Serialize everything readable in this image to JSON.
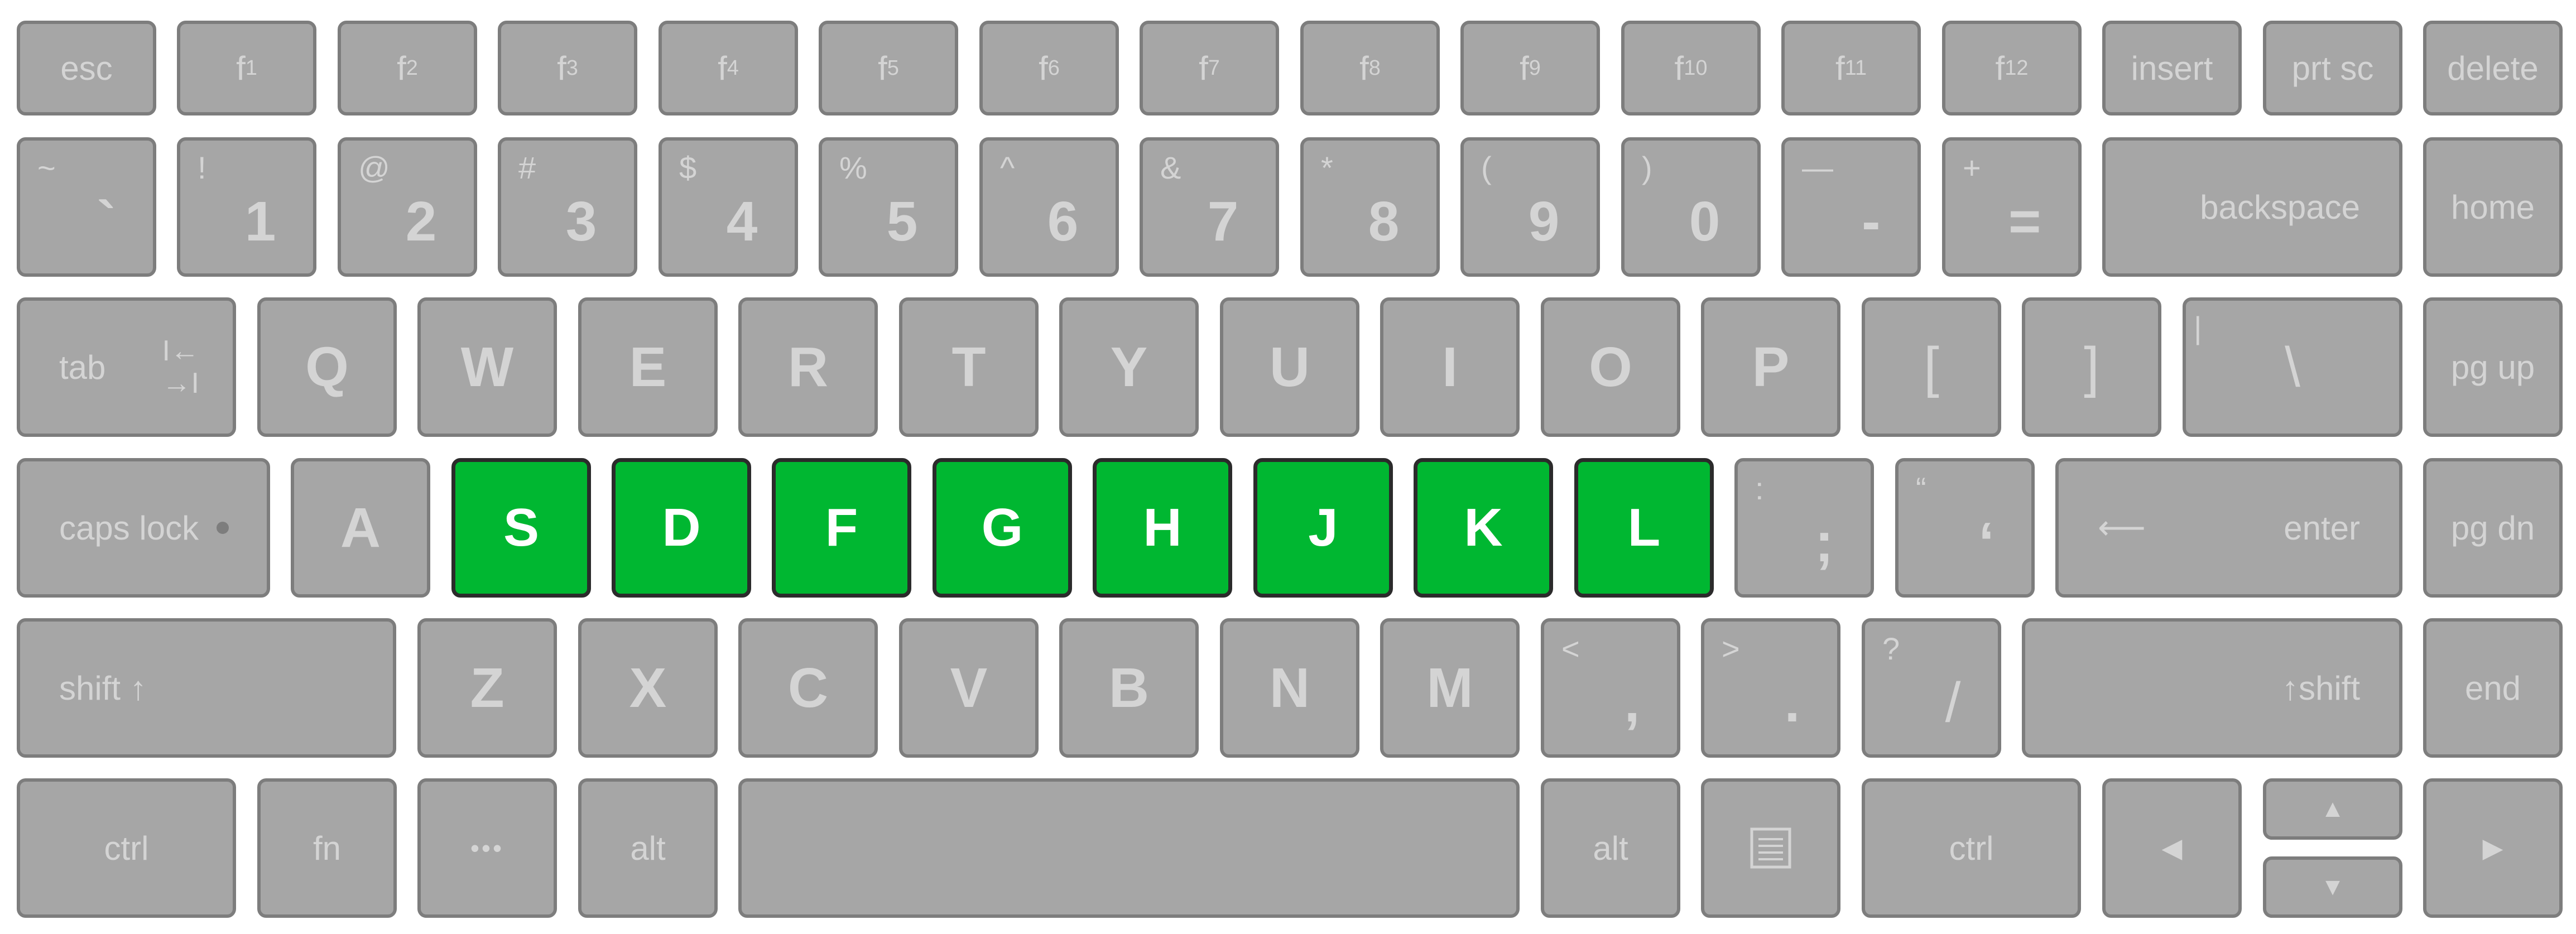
{
  "keyboard": {
    "highlight_color": "#00b731",
    "key_color": "#a6a6a6",
    "row1": {
      "esc": "esc",
      "f_prefix": "f",
      "f_nums": [
        "1",
        "2",
        "3",
        "4",
        "5",
        "6",
        "7",
        "8",
        "9",
        "10",
        "11",
        "12"
      ],
      "insert": "insert",
      "prtsc": "prt sc",
      "delete": "delete"
    },
    "row2": {
      "keys": [
        {
          "top": "~",
          "main": "`"
        },
        {
          "top": "!",
          "main": "1"
        },
        {
          "top": "@",
          "main": "2"
        },
        {
          "top": "#",
          "main": "3"
        },
        {
          "top": "$",
          "main": "4"
        },
        {
          "top": "%",
          "main": "5"
        },
        {
          "top": "^",
          "main": "6"
        },
        {
          "top": "&",
          "main": "7"
        },
        {
          "top": "*",
          "main": "8"
        },
        {
          "top": "(",
          "main": "9"
        },
        {
          "top": ")",
          "main": "0"
        },
        {
          "top": "—",
          "main": "-"
        },
        {
          "top": "+",
          "main": "="
        }
      ],
      "backspace": "backspace",
      "home": "home"
    },
    "row3": {
      "tab": "tab",
      "tab_icon_top": "I←",
      "tab_icon_bottom": "→I",
      "letters": [
        "Q",
        "W",
        "E",
        "R",
        "T",
        "Y",
        "U",
        "I",
        "O",
        "P",
        "[",
        "]"
      ],
      "backslash_top": "|",
      "backslash": "\\",
      "pgup": "pg up"
    },
    "row4": {
      "caps": "caps lock",
      "a": "A",
      "highlighted": [
        "S",
        "D",
        "F",
        "G",
        "H",
        "J",
        "K",
        "L"
      ],
      "semicolon_top": ":",
      "semicolon": ";",
      "quote_top": "“",
      "quote": "‘",
      "enter_arrow": "⟵",
      "enter": "enter",
      "pgdn": "pg dn"
    },
    "row5": {
      "shift_left": "shift ↑",
      "letters": [
        "Z",
        "X",
        "C",
        "V",
        "B",
        "N",
        "M"
      ],
      "comma_top": "<",
      "comma": ",",
      "period_top": ">",
      "period": ".",
      "slash_top": "?",
      "slash": "/",
      "shift_right": "↑shift",
      "end": "end"
    },
    "row6": {
      "ctrl_left": "ctrl",
      "fn": "fn",
      "dots": "•••",
      "alt_left": "alt",
      "alt_right": "alt",
      "ctrl_right": "ctrl",
      "menu_icon": "menu-icon",
      "arrow_left": "◀",
      "arrow_up": "▲",
      "arrow_down": "▼",
      "arrow_right": "▶"
    }
  }
}
